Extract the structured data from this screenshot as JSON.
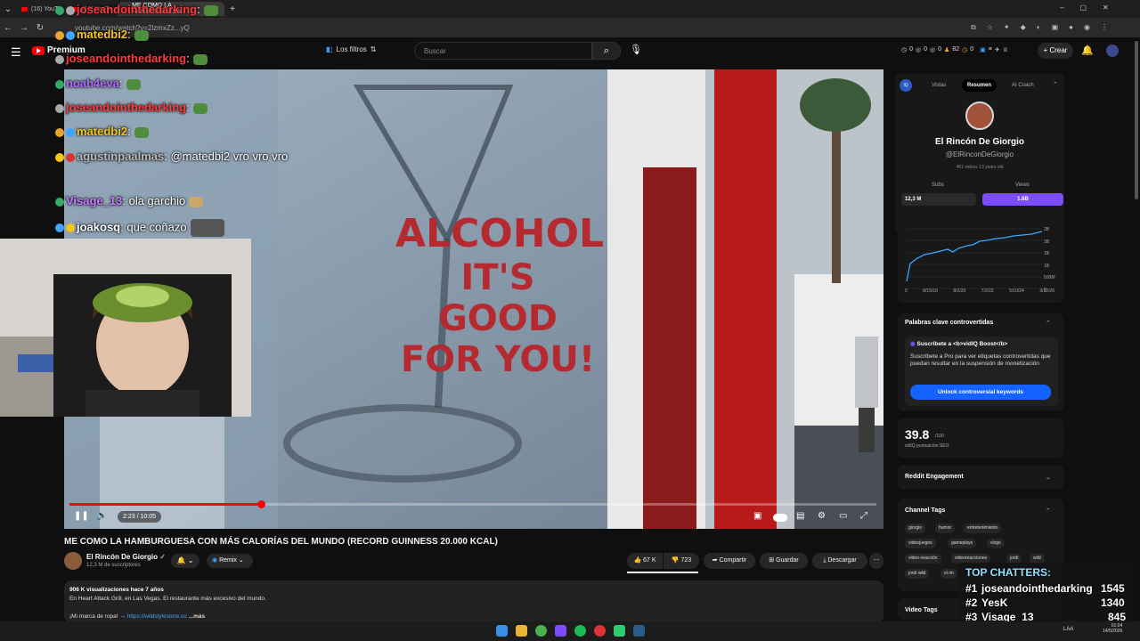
{
  "browser": {
    "tabs": [
      {
        "label": "(16) YouTu"
      },
      {
        "label": "(16) YouTu"
      },
      {
        "label": "ME COMO LA HAMBURGUESA"
      }
    ],
    "url": "youtube.com/watch?v=2lzmxZz...yQ"
  },
  "header": {
    "logo": "Premium",
    "filters": "Los filtros",
    "search_placeholder": "Buscar",
    "stats": [
      "0",
      "0",
      "0",
      "82",
      "0"
    ],
    "create": "Crear"
  },
  "player": {
    "time": "2:23 / 10:05",
    "progress": 0.237
  },
  "video": {
    "title": "ME COMO LA HAMBURGUESA CON MÁS CALORÍAS DEL MUNDO (RECORD GUINNESS 20.000 KCAL)",
    "sign_lines": [
      "ALCOHOL",
      "IT'S GOOD",
      "FOR YOU!"
    ],
    "channel": "El Rincón De Giorgio",
    "subs": "12,3 M de suscriptores",
    "remix": "Remix",
    "likes": "67 K",
    "dislikes": "723",
    "share": "Compartir",
    "save": "Guardar",
    "download": "Descargar",
    "desc_stats": "906 K visualizaciones  hace 7 años",
    "desc_line1": "En Heart Attack Grill, en Las Vegas. El restaurante más excesivo del mundo.",
    "desc_line2": "¡Mi marca de ropa! →",
    "desc_link": "https://wildstylestore.co",
    "desc_more": "...más"
  },
  "chat": [
    {
      "user": "joseandointhedarking",
      "text": ":",
      "color": "#ff3b3b"
    },
    {
      "user": "matedbi2",
      "text": ":",
      "color": "#f5c518"
    },
    {
      "user": "joseandointhedarking",
      "text": ":",
      "color": "#ff3b3b"
    },
    {
      "user": "noah4eva",
      "text": ":",
      "color": "#b36bff"
    },
    {
      "user": "joseandointhedarking",
      "text": ":",
      "color": "#ff3b3b"
    },
    {
      "user": "matedbi2",
      "text": ":",
      "color": "#f5c518"
    },
    {
      "user": "agustinpaalmas",
      "text": ": @matedbi2 vro vro vro",
      "color": "#bbbbbb"
    },
    {
      "user": "Visage_13",
      "text": ": ola garchio",
      "color": "#c77dff"
    },
    {
      "user": "joakosq",
      "text": ": que coñazo",
      "color": "#ffffff"
    }
  ],
  "vidiq": {
    "tabs": [
      "Vistas",
      "Resumen",
      "AI Coach"
    ],
    "badge": "IQ",
    "channel_name": "El Rincón De Giorgio",
    "handle": "@ElRinconDeGiorgio",
    "meta": "461 videos   13 years old",
    "subs_label": "Subs",
    "views_label": "Views",
    "subs_value": "12,3 M",
    "views_value": "1.6B",
    "chart_y_ticks": [
      "2B",
      "2B",
      "1B",
      "1B",
      "500M",
      "0"
    ],
    "chart_x_ticks": [
      "0",
      "8/15/18",
      "8/2/20",
      "7/2/22",
      "5/10/24",
      "3/12/26"
    ],
    "controversial_title": "Palabras clave controvertidas",
    "boost_title": "Suscríbete a <b>vidIQ Boost</b>",
    "boost_body": "Suscríbete a Pro para ver etiquetas controvertidas que puedan resultar en la suspensión de monetización",
    "unlock": "Unlock controversial keywords",
    "seo_score": "39.8",
    "seo_max": "/100",
    "seo_label": "vidIQ puntuación SEO",
    "reddit": "Reddit Engagement",
    "channel_tags_title": "Channel Tags",
    "channel_tags": [
      "giorgio",
      "humor",
      "entretenimiento",
      "videojuegos",
      "gameplays",
      "vlogs",
      "video-reacción",
      "videoreacciones",
      "jordi",
      "wild",
      "jordi wild",
      "el rin"
    ],
    "video_tags_title": "Video Tags"
  },
  "top_chatters": {
    "title": "TOP CHATTERS:",
    "rows": [
      {
        "rank": "#1",
        "name": "joseandointhedarking",
        "count": "1545"
      },
      {
        "rank": "#2",
        "name": "YesK",
        "count": "1340"
      },
      {
        "rank": "#3",
        "name": "Visage_13",
        "count": "845"
      }
    ]
  },
  "taskbar": {
    "lang": "LAA",
    "clock_time": "01:04",
    "clock_date": "14/5/2026"
  }
}
